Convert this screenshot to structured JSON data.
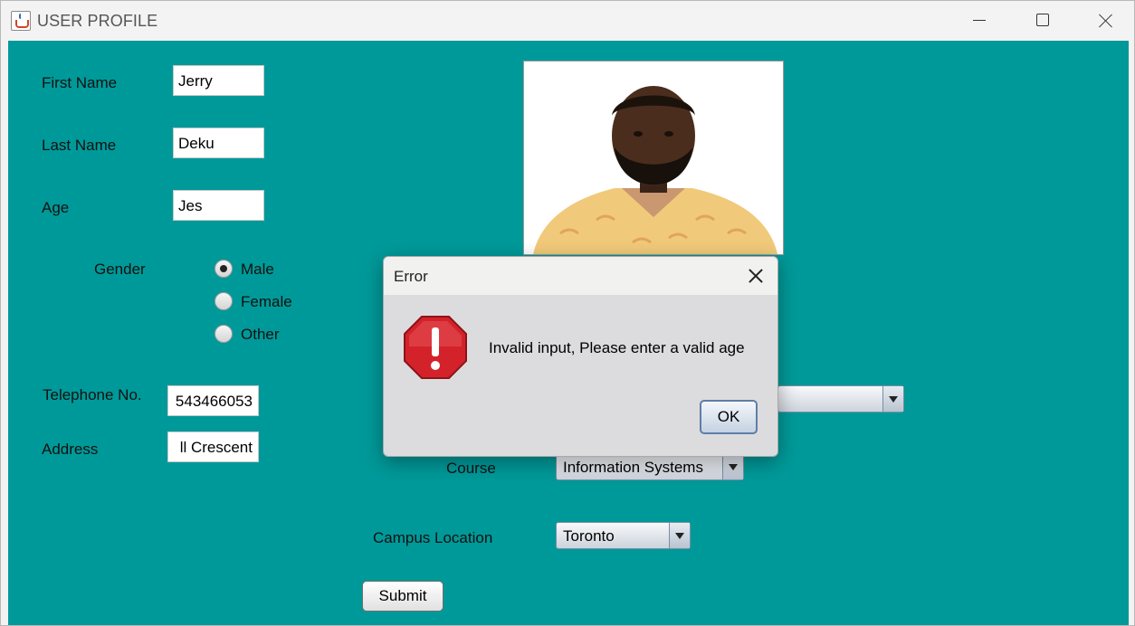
{
  "window": {
    "title": "USER PROFILE"
  },
  "form": {
    "first_name_label": "First Name",
    "first_name_value": "Jerry",
    "last_name_label": "Last Name",
    "last_name_value": "Deku",
    "age_label": "Age",
    "age_value": "Jes",
    "gender_label": "Gender",
    "gender_options": [
      "Male",
      "Female",
      "Other"
    ],
    "gender_selected": "Male",
    "telephone_label": "Telephone No.",
    "telephone_value": "543466053",
    "address_label": "Address",
    "address_value": "ll Crescent",
    "course_label": "Course",
    "course_value": "Information Systems",
    "campus_label": "Campus Location",
    "campus_value": "Toronto",
    "submit_label": "Submit"
  },
  "dialog": {
    "title": "Error",
    "message": "Invalid input, Please enter a valid age",
    "ok_label": "OK",
    "icon": "error-octagon-icon"
  },
  "colors": {
    "background": "#009999",
    "error_icon": "#d3222a"
  }
}
